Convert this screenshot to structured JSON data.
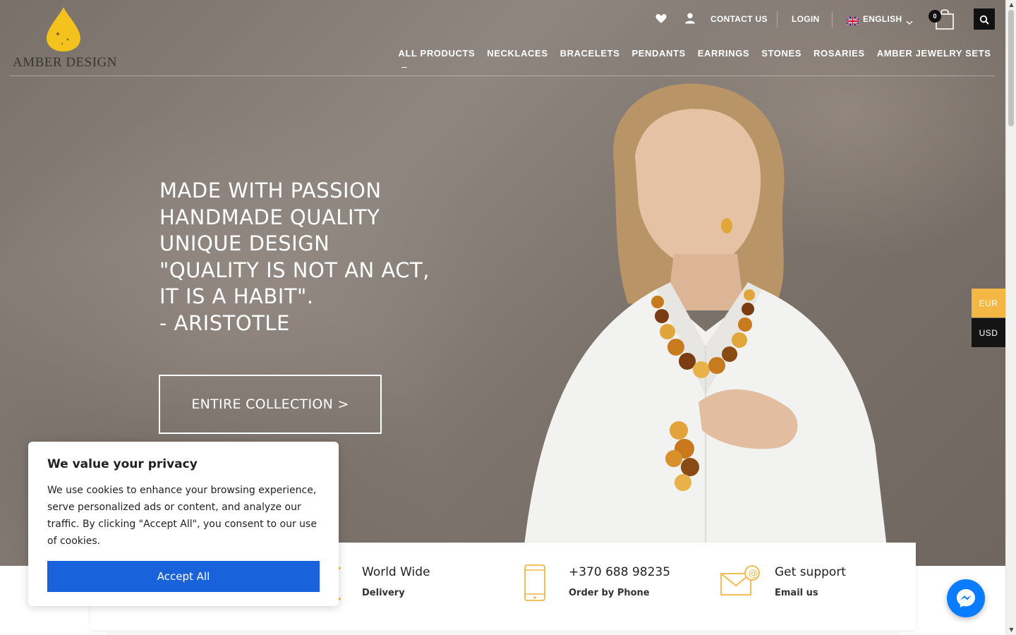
{
  "brand": {
    "name": "AMBER DESIGN"
  },
  "top_bar": {
    "contact_label": "CONTACT US",
    "login_label": "LOGIN",
    "language_label": "ENGLISH",
    "cart_count": "0"
  },
  "nav": {
    "items": [
      {
        "label": "ALL PRODUCTS"
      },
      {
        "label": "NECKLACES"
      },
      {
        "label": "BRACELETS"
      },
      {
        "label": "PENDANTS"
      },
      {
        "label": "EARRINGS"
      },
      {
        "label": "STONES"
      },
      {
        "label": "ROSARIES"
      },
      {
        "label": "AMBER JEWELRY SETS"
      }
    ]
  },
  "hero": {
    "lines": [
      "MADE WITH PASSION",
      "HANDMADE QUALITY",
      "UNIQUE DESIGN",
      "\"QUALITY IS NOT AN ACT,",
      "IT IS A HABIT\".",
      "- ARISTOTLE"
    ],
    "cta_label": "ENTIRE COLLECTION >"
  },
  "currency": {
    "options": [
      "EUR",
      "USD"
    ],
    "selected": "EUR"
  },
  "features": [
    {
      "title": "World Wide",
      "subtitle": "Delivery",
      "icon": "badge-icon"
    },
    {
      "title": "+370 688 98235",
      "subtitle": "Order by Phone",
      "icon": "phone-icon"
    },
    {
      "title": "Get support",
      "subtitle": "Email us",
      "icon": "email-icon"
    }
  ],
  "cookie": {
    "title": "We value your privacy",
    "body": "We use cookies to enhance your browsing experience, serve personalized ads or content, and analyze our traffic. By clicking \"Accept All\", you consent to our use of cookies.",
    "accept_label": "Accept All"
  },
  "colors": {
    "accent": "#f4b744",
    "cookie_button": "#1863dc",
    "messenger": "#0a7cff"
  }
}
